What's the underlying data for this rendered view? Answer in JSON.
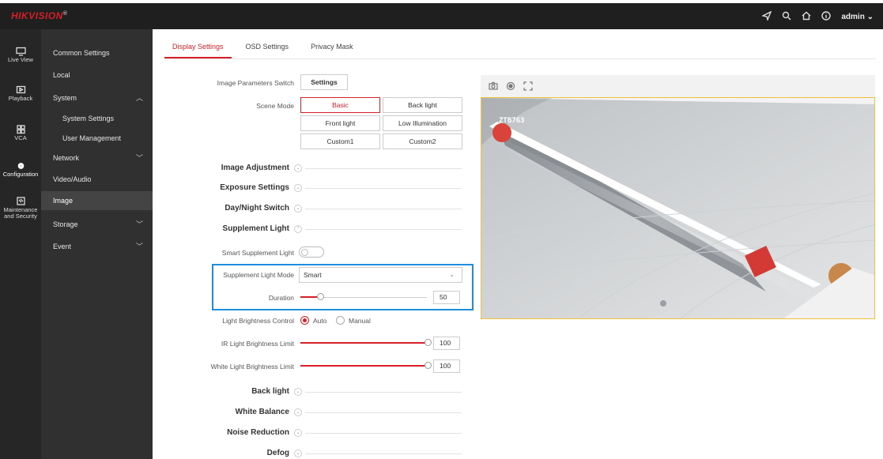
{
  "brand": {
    "name": "HIKVISION",
    "mark": "®"
  },
  "header": {
    "user": "admin"
  },
  "iconbar": [
    {
      "label": "Live View",
      "icon": "monitor-icon"
    },
    {
      "label": "Playback",
      "icon": "playback-icon"
    },
    {
      "label": "VCA",
      "icon": "vca-icon"
    },
    {
      "label": "Configuration",
      "icon": "gear-icon"
    },
    {
      "label": "Maintenance and Security",
      "icon": "maintenance-icon"
    }
  ],
  "menu": {
    "common": "Common Settings",
    "local": "Local",
    "system": "System",
    "system_settings": "System Settings",
    "user_mgmt": "User Management",
    "network": "Network",
    "video_audio": "Video/Audio",
    "image": "Image",
    "storage": "Storage",
    "event": "Event"
  },
  "tabs": [
    "Display Settings",
    "OSD Settings",
    "Privacy Mask"
  ],
  "form": {
    "image_params_switch": "Image Parameters Switch",
    "settings_btn": "Settings",
    "scene_mode": "Scene Mode",
    "scenes": [
      "Basic",
      "Back light",
      "Front light",
      "Low Illumination",
      "Custom1",
      "Custom2"
    ],
    "sections": {
      "image_adjustment": "Image Adjustment",
      "exposure": "Exposure Settings",
      "day_night": "Day/Night Switch",
      "supplement": "Supplement Light",
      "back_light": "Back light",
      "white_balance": "White Balance",
      "noise": "Noise Reduction",
      "defog": "Defog"
    },
    "smart_supplement": "Smart Supplement Light",
    "supp_mode_label": "Supplement Light Mode",
    "supp_mode_value": "Smart",
    "duration_label": "Duration",
    "duration_value": "50",
    "brightness_control": "Light Brightness Control",
    "auto": "Auto",
    "manual": "Manual",
    "ir_limit_label": "IR Light Brightness Limit",
    "ir_limit_value": "100",
    "white_limit_label": "White Light Brightness Limit",
    "white_limit_value": "100"
  },
  "preview": {
    "overlay_text": "ZTB7G3"
  },
  "colors": {
    "accent": "#d61f27",
    "highlight": "#1e8de0"
  }
}
